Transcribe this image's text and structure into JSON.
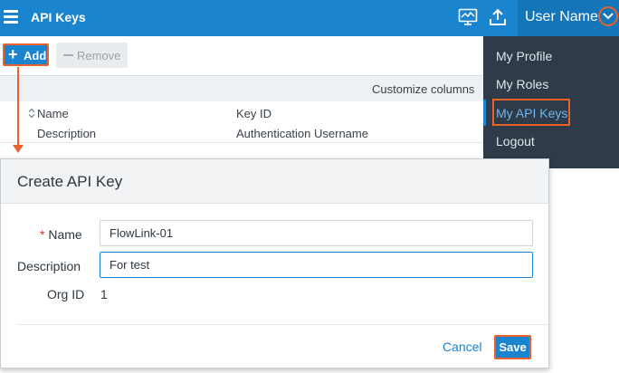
{
  "header": {
    "menu_icon": "hamburger-menu-icon",
    "title": "API Keys",
    "monitor_icon": "monitor-chart-icon",
    "upload_icon": "upload-icon",
    "user_name": "User Name",
    "user_chevron_icon": "chevron-down-circle-icon"
  },
  "toolbar": {
    "add_label": "Add",
    "add_icon": "plus-icon",
    "remove_label": "Remove",
    "remove_icon": "minus-icon"
  },
  "table": {
    "customize_columns": "Customize columns",
    "sort_icon": "sort-icon",
    "columns": {
      "name": "Name",
      "key_id": "Key ID",
      "description": "Description",
      "auth_username": "Authentication Username"
    }
  },
  "user_menu": {
    "items": [
      {
        "label": "My Profile",
        "active": false
      },
      {
        "label": "My Roles",
        "active": false
      },
      {
        "label": "My API Keys",
        "active": true
      },
      {
        "label": "Logout",
        "active": false
      }
    ]
  },
  "modal": {
    "title": "Create API Key",
    "required_mark": "*",
    "name_label": "Name",
    "name_value": "FlowLink-01",
    "description_label": "Description",
    "description_value": "For test",
    "org_id_label": "Org ID",
    "org_id_value": "1",
    "cancel_label": "Cancel",
    "save_label": "Save"
  },
  "colors": {
    "topbar": "#1b84cf",
    "highlight": "#e8622a",
    "menu_bg": "#2f3b49",
    "accent": "#1b84cf"
  }
}
